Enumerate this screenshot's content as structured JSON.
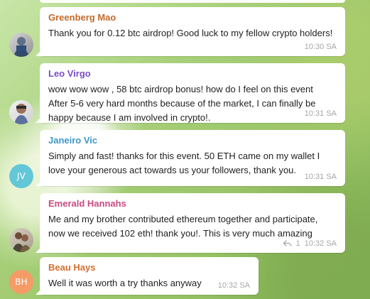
{
  "messages": [
    {
      "sender": "Greenberg Mao",
      "sender_color": "#c46a29",
      "text": "Thank you for 0.12 btc airdrop! Good luck to my fellow crypto holders!",
      "time": "10:30 SA",
      "avatar_type": "photo"
    },
    {
      "sender": "Leo Virgo",
      "sender_color": "#7a4ec6",
      "text": "wow wow wow , 58 btc airdrop bonus! how do I feel on this event\nAfter 5-6 very hard months because of the market, I can finally be happy because I am involved in crypto!.",
      "time": "10:31 SA",
      "avatar_type": "photo"
    },
    {
      "sender": "Janeiro Vic",
      "sender_color": "#3d98c8",
      "text": "Simply and fast! thanks for this event. 50 ETH came on my wallet I love your generous act towards us your followers, thank you.",
      "time": "10:31 SA",
      "avatar_type": "initials",
      "avatar_text": "JV",
      "avatar_color": "#63c7d8"
    },
    {
      "sender": "Emerald Hannahs",
      "sender_color": "#c64b7f",
      "text": "Me and my brother contributed ethereum together and participate, now we received 102 eth! thank you!. This is very much amazing",
      "time": "10:32 SA",
      "reply_count": "1",
      "avatar_type": "photo"
    },
    {
      "sender": "Beau Hays",
      "sender_color": "#d46f2d",
      "text": "Well it was worth a try thanks anyway",
      "time": "10:32 SA",
      "avatar_type": "initials",
      "avatar_text": "BH",
      "avatar_color": "#f59b66"
    }
  ],
  "icons": {
    "reply": "reply-icon"
  }
}
